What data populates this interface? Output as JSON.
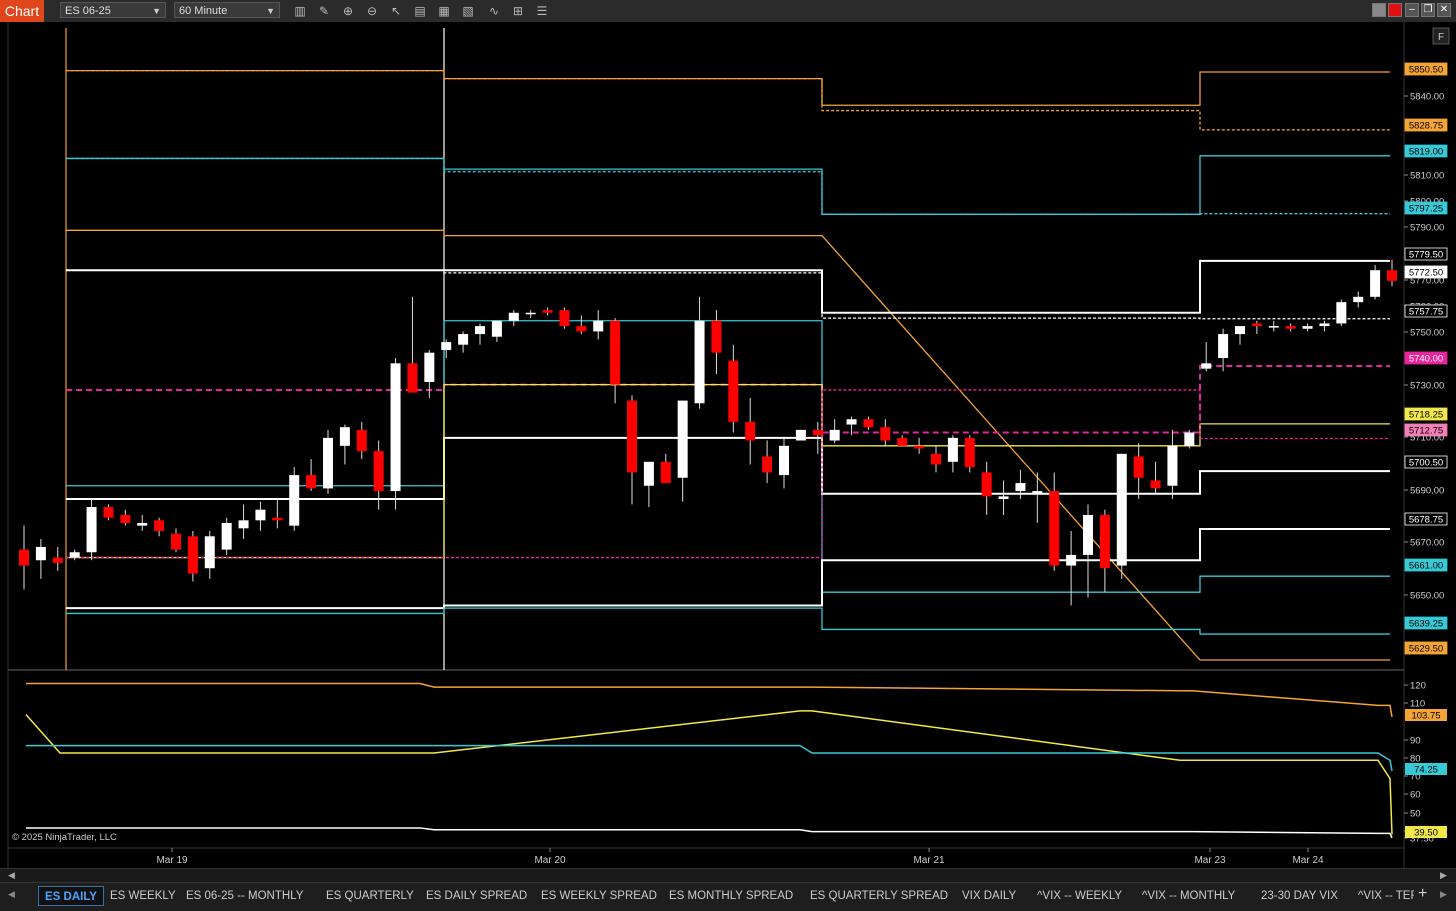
{
  "toolbar": {
    "chart_tab": "Chart",
    "instrument": "ES 06-25",
    "interval": "60 Minute",
    "f_button": "F"
  },
  "colors": {
    "orange": "#f4a434",
    "cyan": "#36c9d6",
    "white": "#ffffff",
    "magenta": "#e8259b",
    "yellow": "#f2e84a",
    "up_candle": "#ffffff",
    "down_candle": "#ff0000",
    "tab_active": "#4aa3ff"
  },
  "copyright": "© 2025 NinjaTrader, LLC",
  "x_axis_labels": [
    "Mar 19",
    "Mar 20",
    "Mar 21",
    "Mar 23",
    "Mar 24"
  ],
  "price_axis": {
    "ticks": [
      "5840.00",
      "5810.00",
      "5800.00",
      "5790.00",
      "5770.00",
      "5760.00",
      "5750.00",
      "5730.00",
      "5710.00",
      "5690.00",
      "5670.00",
      "5650.00"
    ],
    "markers": [
      {
        "text": "5850.50",
        "color": "orange"
      },
      {
        "text": "5828.75",
        "color": "orange"
      },
      {
        "text": "5819.00",
        "color": "cyan"
      },
      {
        "text": "5797.25",
        "color": "cyan"
      },
      {
        "text": "5779.50",
        "color": "white_outline"
      },
      {
        "text": "5772.50",
        "color": "black_outline"
      },
      {
        "text": "5757.75",
        "color": "white_outline"
      },
      {
        "text": "5740.00",
        "color": "magenta"
      },
      {
        "text": "5718.25",
        "color": "yellow"
      },
      {
        "text": "5712.75",
        "color": "pink"
      },
      {
        "text": "5700.50",
        "color": "white_outline"
      },
      {
        "text": "5678.75",
        "color": "white_outline"
      },
      {
        "text": "5661.00",
        "color": "cyan"
      },
      {
        "text": "5639.25",
        "color": "cyan"
      },
      {
        "text": "5629.50",
        "color": "orange"
      }
    ]
  },
  "vol_axis": {
    "ticks": [
      "120",
      "110",
      "90",
      "80",
      "70",
      "60",
      "50",
      "40",
      "37.50"
    ],
    "markers": [
      {
        "text": "103.75",
        "color": "orange"
      },
      {
        "text": "74.25",
        "color": "cyan"
      },
      {
        "text": "39.50",
        "color": "yellow"
      }
    ]
  },
  "tabs": [
    "ES DAILY",
    "ES WEEKLY",
    "ES 06-25 -- MONTHLY",
    "ES QUARTERLY",
    "ES DAILY SPREAD",
    "ES WEEKLY SPREAD",
    "ES MONTHLY SPREAD",
    "ES QUARTERLY SPREAD",
    "VIX DAILY",
    "^VIX -- WEEKLY",
    "^VIX -- MONTHLY",
    "23-30 DAY VIX",
    "^VIX -- TER"
  ],
  "chart_data": {
    "type": "candlestick",
    "instrument": "ES 06-25",
    "interval": "60 Minute",
    "candles": [
      {
        "o": 5671,
        "h": 5680,
        "l": 5656,
        "c": 5665
      },
      {
        "o": 5667,
        "h": 5675,
        "l": 5660,
        "c": 5672
      },
      {
        "o": 5668,
        "h": 5672,
        "l": 5663,
        "c": 5666
      },
      {
        "o": 5668,
        "h": 5671,
        "l": 5667,
        "c": 5670
      },
      {
        "o": 5670,
        "h": 5690,
        "l": 5667,
        "c": 5687
      },
      {
        "o": 5687,
        "h": 5688,
        "l": 5682,
        "c": 5683
      },
      {
        "o": 5684,
        "h": 5686,
        "l": 5680,
        "c": 5681
      },
      {
        "o": 5680,
        "h": 5684,
        "l": 5678,
        "c": 5681
      },
      {
        "o": 5682,
        "h": 5683,
        "l": 5676,
        "c": 5678
      },
      {
        "o": 5677,
        "h": 5679,
        "l": 5670,
        "c": 5671
      },
      {
        "o": 5676,
        "h": 5678,
        "l": 5659,
        "c": 5662
      },
      {
        "o": 5664,
        "h": 5678,
        "l": 5660,
        "c": 5676
      },
      {
        "o": 5671,
        "h": 5683,
        "l": 5669,
        "c": 5681
      },
      {
        "o": 5679,
        "h": 5688,
        "l": 5675,
        "c": 5682
      },
      {
        "o": 5682,
        "h": 5689,
        "l": 5678,
        "c": 5686
      },
      {
        "o": 5683,
        "h": 5690,
        "l": 5679,
        "c": 5682
      },
      {
        "o": 5680,
        "h": 5702,
        "l": 5678,
        "c": 5699
      },
      {
        "o": 5699,
        "h": 5705,
        "l": 5693,
        "c": 5694
      },
      {
        "o": 5694,
        "h": 5716,
        "l": 5692,
        "c": 5713
      },
      {
        "o": 5710,
        "h": 5718,
        "l": 5703,
        "c": 5717
      },
      {
        "o": 5716,
        "h": 5719,
        "l": 5705,
        "c": 5708
      },
      {
        "o": 5708,
        "h": 5712,
        "l": 5686,
        "c": 5693
      },
      {
        "o": 5693,
        "h": 5743,
        "l": 5686,
        "c": 5741
      },
      {
        "o": 5741,
        "h": 5766,
        "l": 5731,
        "c": 5730
      },
      {
        "o": 5734,
        "h": 5746,
        "l": 5728,
        "c": 5745
      },
      {
        "o": 5746,
        "h": 5750,
        "l": 5743,
        "c": 5749
      },
      {
        "o": 5748,
        "h": 5753,
        "l": 5745,
        "c": 5752
      },
      {
        "o": 5752,
        "h": 5756,
        "l": 5748,
        "c": 5755
      },
      {
        "o": 5751,
        "h": 5757,
        "l": 5749,
        "c": 5757
      },
      {
        "o": 5757,
        "h": 5761,
        "l": 5755,
        "c": 5760
      },
      {
        "o": 5760,
        "h": 5761,
        "l": 5758,
        "c": 5760
      },
      {
        "o": 5761,
        "h": 5762,
        "l": 5759,
        "c": 5760
      },
      {
        "o": 5761,
        "h": 5762,
        "l": 5754,
        "c": 5755
      },
      {
        "o": 5755,
        "h": 5759,
        "l": 5752,
        "c": 5753
      },
      {
        "o": 5753,
        "h": 5761,
        "l": 5750,
        "c": 5757
      },
      {
        "o": 5757,
        "h": 5758,
        "l": 5726,
        "c": 5733
      },
      {
        "o": 5727,
        "h": 5729,
        "l": 5688,
        "c": 5700
      },
      {
        "o": 5695,
        "h": 5703,
        "l": 5687,
        "c": 5704
      },
      {
        "o": 5704,
        "h": 5707,
        "l": 5697,
        "c": 5696
      },
      {
        "o": 5698,
        "h": 5716,
        "l": 5689,
        "c": 5727
      },
      {
        "o": 5726,
        "h": 5766,
        "l": 5724,
        "c": 5757
      },
      {
        "o": 5757,
        "h": 5761,
        "l": 5737,
        "c": 5745
      },
      {
        "o": 5742,
        "h": 5748,
        "l": 5715,
        "c": 5719
      },
      {
        "o": 5719,
        "h": 5728,
        "l": 5703,
        "c": 5712
      },
      {
        "o": 5706,
        "h": 5712,
        "l": 5696,
        "c": 5700
      },
      {
        "o": 5699,
        "h": 5713,
        "l": 5694,
        "c": 5710
      },
      {
        "o": 5712,
        "h": 5716,
        "l": 5712,
        "c": 5716
      },
      {
        "o": 5716,
        "h": 5719,
        "l": 5707,
        "c": 5714
      },
      {
        "o": 5712,
        "h": 5720,
        "l": 5711,
        "c": 5716
      },
      {
        "o": 5718,
        "h": 5721,
        "l": 5714,
        "c": 5720
      },
      {
        "o": 5720,
        "h": 5721,
        "l": 5716,
        "c": 5717
      },
      {
        "o": 5717,
        "h": 5720,
        "l": 5710,
        "c": 5712
      },
      {
        "o": 5713,
        "h": 5714,
        "l": 5710,
        "c": 5710
      },
      {
        "o": 5710,
        "h": 5713,
        "l": 5707,
        "c": 5709
      },
      {
        "o": 5707,
        "h": 5710,
        "l": 5700,
        "c": 5703
      },
      {
        "o": 5704,
        "h": 5714,
        "l": 5700,
        "c": 5713
      },
      {
        "o": 5713,
        "h": 5714,
        "l": 5700,
        "c": 5702
      },
      {
        "o": 5700,
        "h": 5704,
        "l": 5684,
        "c": 5691
      },
      {
        "o": 5690,
        "h": 5697,
        "l": 5684,
        "c": 5691
      },
      {
        "o": 5693,
        "h": 5701,
        "l": 5690,
        "c": 5696
      },
      {
        "o": 5692,
        "h": 5700,
        "l": 5681,
        "c": 5693
      },
      {
        "o": 5693,
        "h": 5700,
        "l": 5663,
        "c": 5665
      },
      {
        "o": 5665,
        "h": 5678,
        "l": 5650,
        "c": 5669
      },
      {
        "o": 5669,
        "h": 5688,
        "l": 5653,
        "c": 5684
      },
      {
        "o": 5684,
        "h": 5686,
        "l": 5655,
        "c": 5664
      },
      {
        "o": 5665,
        "h": 5707,
        "l": 5660,
        "c": 5707
      },
      {
        "o": 5706,
        "h": 5711,
        "l": 5690,
        "c": 5698
      },
      {
        "o": 5697,
        "h": 5704,
        "l": 5692,
        "c": 5694
      },
      {
        "o": 5695,
        "h": 5716,
        "l": 5690,
        "c": 5710
      },
      {
        "o": 5710,
        "h": 5716,
        "l": 5709,
        "c": 5715
      },
      {
        "o": 5739,
        "h": 5749,
        "l": 5738,
        "c": 5741
      },
      {
        "o": 5743,
        "h": 5754,
        "l": 5738,
        "c": 5752
      },
      {
        "o": 5752,
        "h": 5755,
        "l": 5748,
        "c": 5755
      },
      {
        "o": 5756,
        "h": 5757,
        "l": 5752,
        "c": 5755
      },
      {
        "o": 5755,
        "h": 5757,
        "l": 5753,
        "c": 5755
      },
      {
        "o": 5755,
        "h": 5756,
        "l": 5753,
        "c": 5754
      },
      {
        "o": 5754,
        "h": 5756,
        "l": 5753,
        "c": 5755
      },
      {
        "o": 5755,
        "h": 5757,
        "l": 5753,
        "c": 5756
      },
      {
        "o": 5756,
        "h": 5765,
        "l": 5755,
        "c": 5764
      },
      {
        "o": 5764,
        "h": 5768,
        "l": 5762,
        "c": 5766
      },
      {
        "o": 5766,
        "h": 5778,
        "l": 5765,
        "c": 5776
      },
      {
        "o": 5776,
        "h": 5780,
        "l": 5770,
        "c": 5772
      }
    ],
    "level_lines": [
      {
        "name": "orange-upper",
        "color": "orange",
        "values": [
          5851,
          5848,
          5838,
          5850.5
        ]
      },
      {
        "name": "orange-upper-dash",
        "color": "orange",
        "values": [
          5851,
          5848,
          5836,
          5828.75
        ]
      },
      {
        "name": "orange-lower",
        "color": "orange",
        "values": [
          5791,
          5789,
          null,
          5629.5
        ]
      },
      {
        "name": "cyan-upper",
        "color": "cyan",
        "values": [
          5818,
          5814,
          5797,
          5819
        ]
      },
      {
        "name": "cyan-upper-dash",
        "color": "cyan",
        "values": [
          5818,
          5813,
          5797,
          5797.25
        ]
      },
      {
        "name": "white-upper",
        "color": "white",
        "values": [
          5776,
          5776,
          5760,
          5779.5
        ]
      },
      {
        "name": "white-upper-dash",
        "color": "white",
        "values": [
          5776,
          5775,
          5758,
          5757.75
        ]
      },
      {
        "name": "cyan-mid",
        "color": "cyan",
        "values": [
          5695,
          5757,
          5655,
          5661
        ]
      },
      {
        "name": "white-mid",
        "color": "white",
        "values": [
          5690,
          5713,
          5692,
          5700.5
        ]
      },
      {
        "name": "white-lower",
        "color": "white",
        "values": [
          5649,
          5650,
          5667,
          5678.75
        ]
      },
      {
        "name": "cyan-lower",
        "color": "cyan",
        "values": [
          5647,
          5649,
          5641,
          5639.25
        ]
      },
      {
        "name": "magenta",
        "color": "magenta",
        "values": [
          5731,
          5733,
          5715,
          5740
        ]
      },
      {
        "name": "yellow",
        "color": "yellow",
        "values": [
          5668,
          5733,
          5710,
          5718.25
        ]
      },
      {
        "name": "pink-dotted",
        "color": "magenta",
        "values": [
          5668,
          5668,
          5731,
          5712.75
        ]
      }
    ],
    "lower_panel": {
      "ylim": [
        37.5,
        125
      ],
      "series": [
        {
          "name": "orange",
          "color": "orange",
          "values": [
            122,
            122,
            122,
            120,
            120,
            120,
            118,
            118,
            110,
            110,
            103.75
          ]
        },
        {
          "name": "yellow",
          "color": "yellow",
          "values": [
            105,
            84,
            84,
            84,
            107,
            107,
            80,
            80,
            80,
            70,
            39.5
          ]
        },
        {
          "name": "cyan",
          "color": "cyan",
          "values": [
            88,
            88,
            88,
            88,
            88,
            84,
            84,
            84,
            84,
            80,
            74.25
          ]
        },
        {
          "name": "white",
          "color": "white",
          "values": [
            43,
            43,
            43,
            42,
            42,
            41,
            41,
            41,
            40,
            40,
            37.5
          ]
        }
      ]
    }
  }
}
